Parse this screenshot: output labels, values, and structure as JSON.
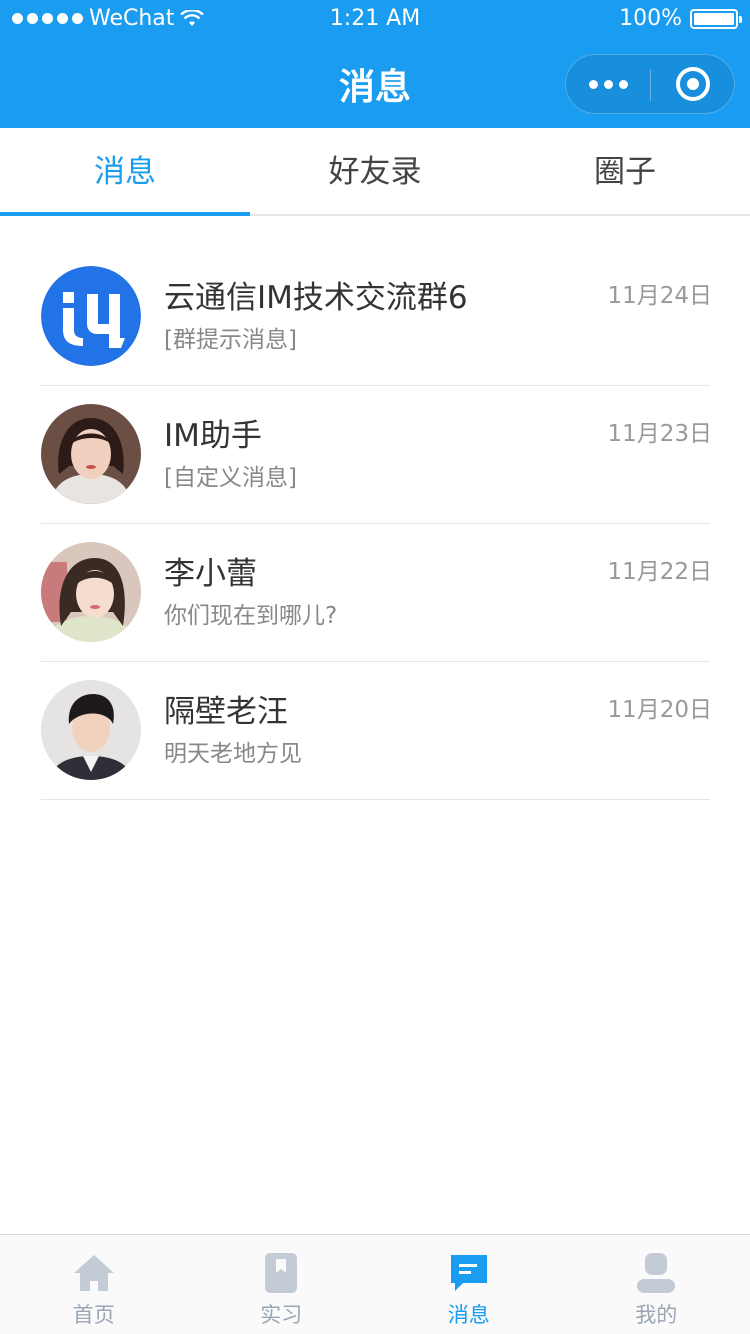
{
  "status_bar": {
    "carrier": "WeChat",
    "time": "1:21 AM",
    "battery": "100%"
  },
  "nav": {
    "title": "消息"
  },
  "tabs": [
    {
      "label": "消息",
      "active": true
    },
    {
      "label": "好友录",
      "active": false
    },
    {
      "label": "圈子",
      "active": false
    }
  ],
  "conversations": [
    {
      "name": "云通信IM技术交流群6",
      "preview": "[群提示消息]",
      "date": "11月24日",
      "avatar": "group-logo"
    },
    {
      "name": "IM助手",
      "preview": "[自定义消息]",
      "date": "11月23日",
      "avatar": "user-photo"
    },
    {
      "name": "李小蕾",
      "preview": "你们现在到哪儿?",
      "date": "11月22日",
      "avatar": "user-photo"
    },
    {
      "name": "隔壁老汪",
      "preview": "明天老地方见",
      "date": "11月20日",
      "avatar": "user-photo"
    }
  ],
  "tabbar": [
    {
      "label": "首页",
      "icon": "home-icon",
      "active": false
    },
    {
      "label": "实习",
      "icon": "bookmark-icon",
      "active": false
    },
    {
      "label": "消息",
      "icon": "chat-icon",
      "active": true
    },
    {
      "label": "我的",
      "icon": "profile-icon",
      "active": false
    }
  ],
  "colors": {
    "primary": "#1a9cf0",
    "inactive": "#9aa6b4"
  }
}
